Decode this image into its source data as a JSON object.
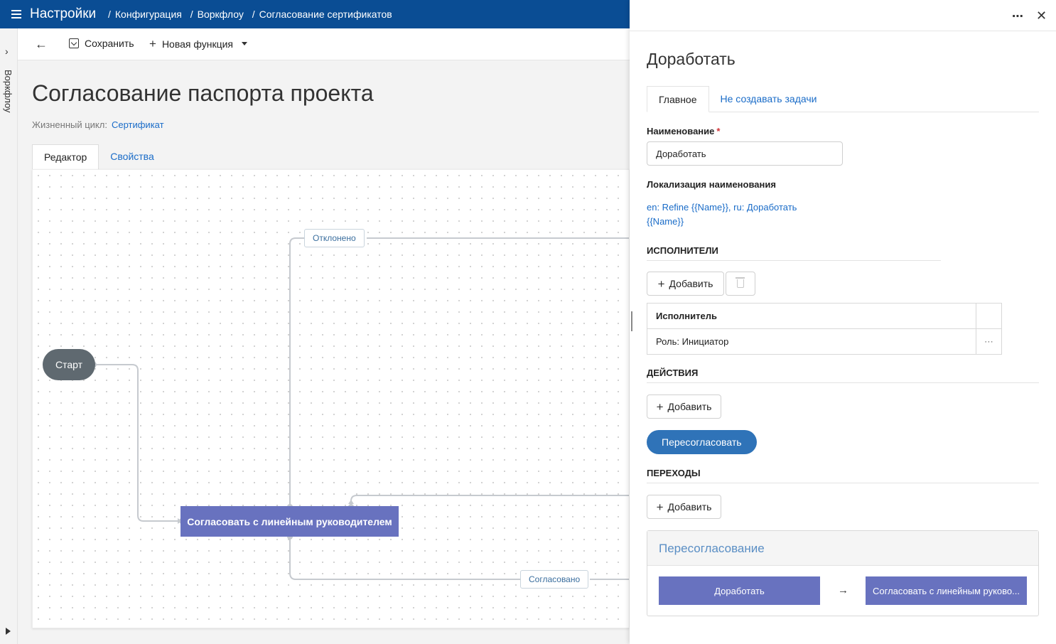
{
  "header": {
    "app_title": "Настройки",
    "breadcrumbs": [
      "Конфигурация",
      "Воркфлоу",
      "Согласование сертификатов"
    ]
  },
  "left_rail": {
    "label": "Воркфлоу"
  },
  "toolbar": {
    "save_label": "Сохранить",
    "new_function_label": "Новая функция"
  },
  "page": {
    "title": "Согласование паспорта проекта",
    "lifecycle_label": "Жизненный цикл:",
    "lifecycle_value": "Сертификат",
    "tabs": [
      {
        "label": "Редактор",
        "active": true
      },
      {
        "label": "Свойства",
        "active": false
      }
    ]
  },
  "diagram": {
    "start_node": "Старт",
    "task_node": "Согласовать с линейным руководителем",
    "edge_labels": {
      "rejected": "Отклонено",
      "approved": "Согласовано"
    }
  },
  "panel": {
    "title": "Доработать",
    "tabs": [
      {
        "label": "Главное",
        "active": true
      },
      {
        "label": "Не создавать задачи",
        "active": false
      }
    ],
    "name_label": "Наименование",
    "required_mark": "*",
    "name_value": "Доработать",
    "localization_label": "Локализация наименования",
    "localization_value": "en: Refine {{Name}}, ru: Доработать {{Name}}",
    "executors": {
      "section_title": "ИСПОЛНИТЕЛИ",
      "add_label": "Добавить",
      "table_header": "Исполнитель",
      "rows": [
        "Роль: Инициатор"
      ]
    },
    "actions": {
      "section_title": "ДЕЙСТВИЯ",
      "add_label": "Добавить",
      "items": [
        "Пересогласовать"
      ]
    },
    "transitions": {
      "section_title": "ПЕРЕХОДЫ",
      "add_label": "Добавить",
      "card_title": "Пересогласование",
      "from": "Доработать",
      "arrow": "→",
      "to": "Согласовать с линейным руково..."
    }
  },
  "colors": {
    "header_bg": "#0a4d94",
    "task_node": "#6872bf",
    "start_node": "#5f6970",
    "link": "#1a6cc8",
    "primary_pill": "#2f73b8"
  }
}
